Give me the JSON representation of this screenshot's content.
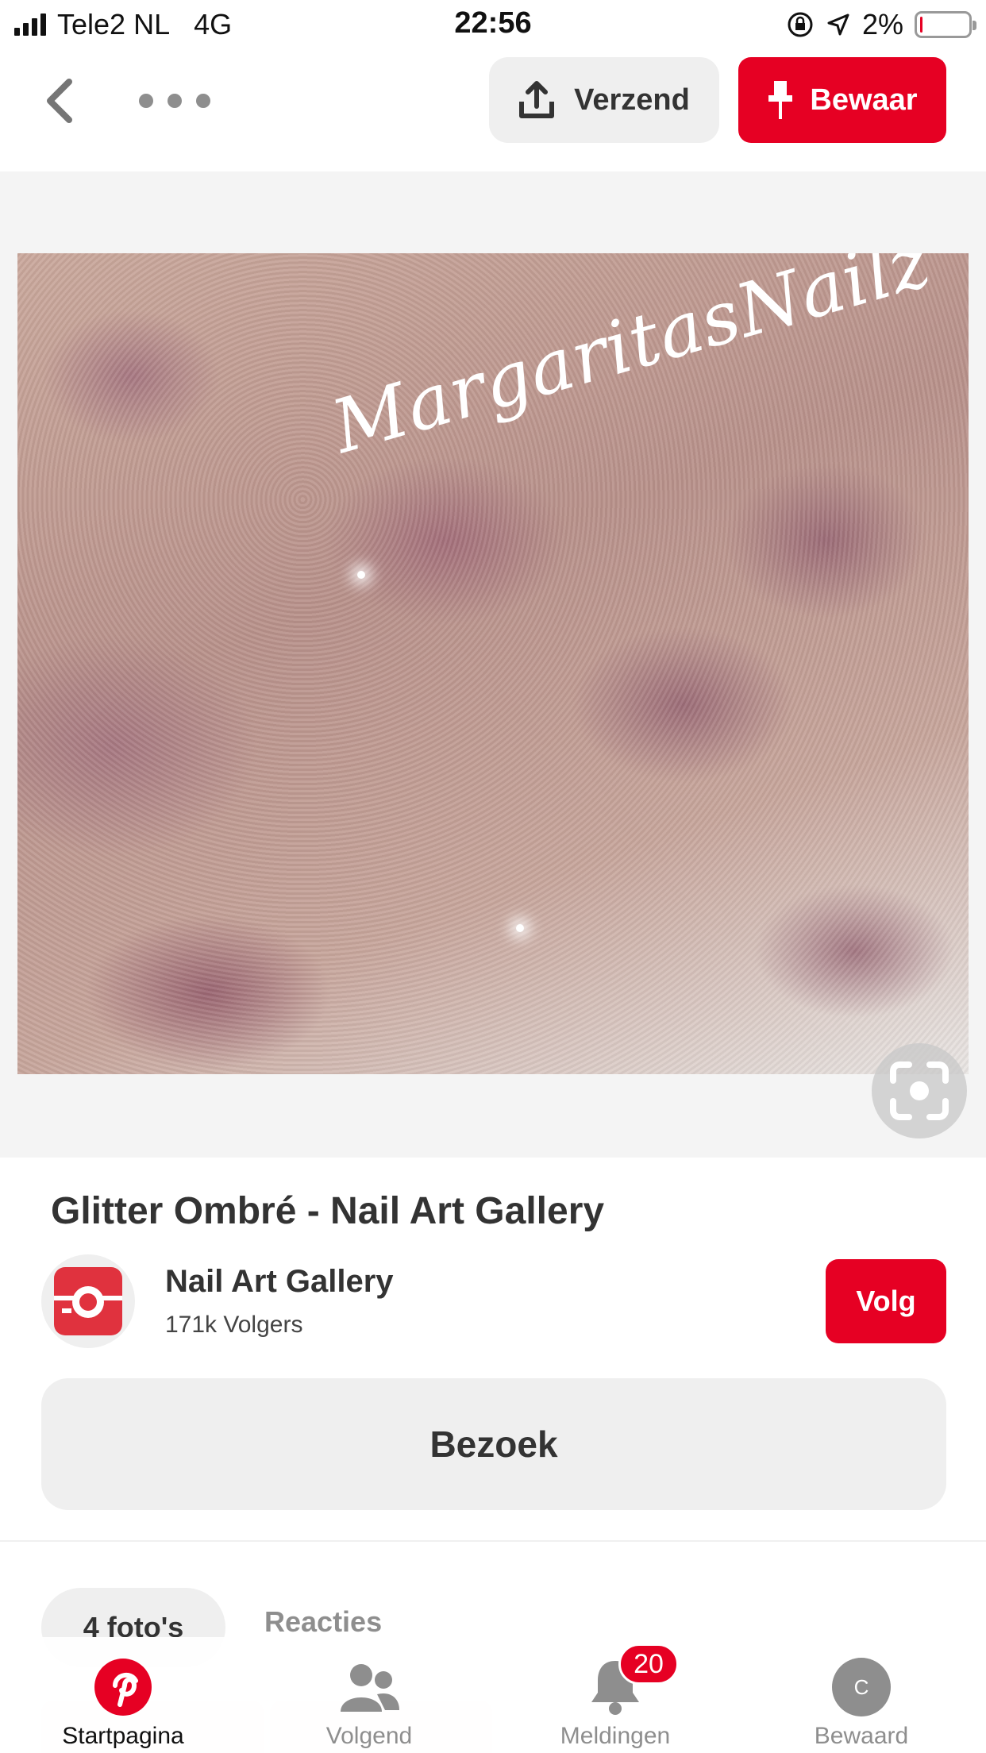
{
  "status_bar": {
    "carrier": "Tele2 NL",
    "network": "4G",
    "time": "22:56",
    "battery_percent": "2%",
    "battery_level": 0.02
  },
  "header": {
    "send_label": "Verzend",
    "save_label": "Bewaar",
    "icons": [
      "back-chevron-icon",
      "more-dots-icon",
      "share-upload-icon",
      "pin-icon"
    ]
  },
  "pin": {
    "image_watermark": "MargaritasNailz",
    "title": "Glitter Ombré - Nail Art Gallery"
  },
  "board": {
    "name": "Nail Art Gallery",
    "followers": "171k Volgers",
    "follow_label": "Volg"
  },
  "visit_label": "Bezoek",
  "tabs": {
    "photos": "4 foto's",
    "comments": "Reacties"
  },
  "bottom_nav": {
    "home": "Startpagina",
    "following": "Volgend",
    "notifications": "Meldingen",
    "notifications_badge": "20",
    "saved": "Bewaard",
    "avatar_letter": "C"
  },
  "colors": {
    "accent": "#e60023",
    "button_gray": "#efefef",
    "text_gray": "#8e8e8e"
  }
}
